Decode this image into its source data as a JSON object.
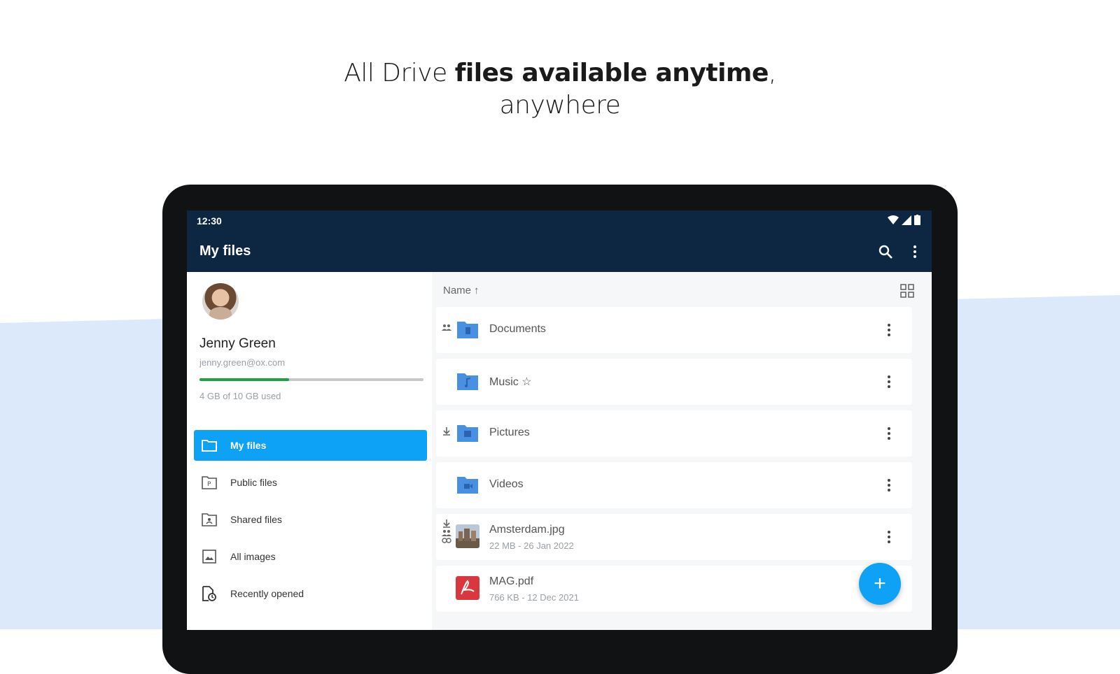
{
  "colors": {
    "appbar": "#0d2743",
    "accent": "#0ea2f6",
    "storage_fill": "#1aa33f",
    "folder_blue": "#4a90e2",
    "pdf_red": "#d9363e",
    "background_band": "#dbe9fb"
  },
  "headline": {
    "part1": "All Drive ",
    "part2": "files available anytime",
    "part3": ",",
    "line2": "anywhere"
  },
  "status": {
    "time": "12:30",
    "icons": [
      "wifi-icon",
      "signal-icon",
      "battery-icon"
    ]
  },
  "appbar": {
    "title": "My files",
    "actions": [
      "search-icon",
      "more-vert-icon"
    ]
  },
  "drawer": {
    "user_name": "Jenny Green",
    "user_email": "jenny.green@ox.com",
    "storage_text": "4 GB of 10 GB used",
    "storage_fraction": 0.4,
    "items": [
      {
        "label": "My files",
        "icon": "folder-icon",
        "active": true
      },
      {
        "label": "Public files",
        "icon": "public-files-icon",
        "active": false
      },
      {
        "label": "Shared files",
        "icon": "shared-files-icon",
        "active": false
      },
      {
        "label": "All images",
        "icon": "image-icon",
        "active": false
      },
      {
        "label": "Recently opened",
        "icon": "recent-file-icon",
        "active": false
      }
    ]
  },
  "content": {
    "sort_label": "Name",
    "sort_arrow": "↑",
    "files": [
      {
        "name": "Documents",
        "meta": "",
        "icon": "folder-documents-icon",
        "badges": [
          "shared-icon"
        ],
        "starred": false
      },
      {
        "name": "Music",
        "meta": "",
        "icon": "folder-music-icon",
        "badges": [],
        "starred": true
      },
      {
        "name": "Pictures",
        "meta": "",
        "icon": "folder-pictures-icon",
        "badges": [
          "offline-icon"
        ],
        "starred": false
      },
      {
        "name": "Videos",
        "meta": "",
        "icon": "folder-videos-icon",
        "badges": [],
        "starred": false
      },
      {
        "name": "Amsterdam.jpg",
        "meta": "22 MB - 26 Jan 2022",
        "icon": "image-thumbnail",
        "badges": [
          "offline-icon",
          "shared-icon",
          "link-icon"
        ],
        "starred": false
      },
      {
        "name": "MAG.pdf",
        "meta": "766 KB - 12 Dec 2021",
        "icon": "pdf-icon",
        "badges": [],
        "starred": false
      }
    ],
    "fab_label": "+"
  }
}
